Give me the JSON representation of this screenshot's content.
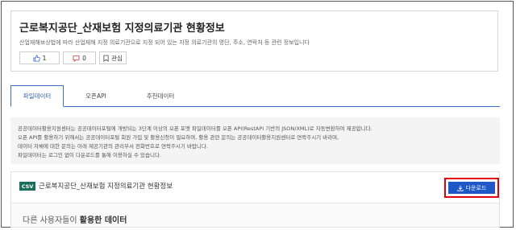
{
  "header": {
    "title": "근로복지공단_산재보험 지정의료기관 현황정보",
    "description": "산업재해보상법에 따라 산업재해 지정 의료기관으로 지정 되어 있는 지정 의료기관의 명단, 주소, 연락처 등 관련 정보입니다",
    "like_count": "1",
    "comment_count": "0",
    "interest_label": "관심"
  },
  "tabs": [
    {
      "label": "파일데이터",
      "active": true
    },
    {
      "label": "오픈API",
      "active": false
    },
    {
      "label": "추천데이터",
      "active": false
    }
  ],
  "info": {
    "line1": "공공데이터활용지원센터는 공공데이터포털에 개방되는 3단계 이상의 오픈 포맷 파일데이터를 오픈 API(RestAPI 기반의 JSON/XML)로 자동변환하여 제공합니다.",
    "line2": "오픈 API를 활용하기 위해서는 공공데이터포털 회원 가입 및 활용신청이 필요하며, 활용 관련 문의는 공공데이터활용지원센터로 연락주시기 바라며,",
    "line3": "데이터 자체에 대한 문의는 아래 제공기관의 관리부서 전화번호로 연락주시기 바랍니다.",
    "line4": "파일데이터는 로그인 없이 다운로드를 통해 이용하실 수 있습니다."
  },
  "file": {
    "format": "CSV",
    "name": "근로복지공단_산재보험 지정의료기관 현황정보",
    "download_label": "다운로드"
  },
  "others": {
    "prefix": "다른 사용자들이 ",
    "emphasis": "활용한 데이터"
  },
  "colors": {
    "tab_accent": "#3a6fc4",
    "download_button": "#1e58c8",
    "highlight_outline": "#e0000f",
    "csv_badge": "#1b6d5c"
  }
}
